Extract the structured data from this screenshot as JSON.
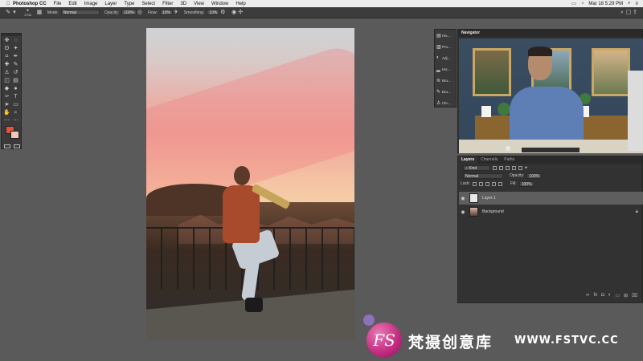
{
  "menubar": {
    "app_name": "Photoshop CC",
    "items": [
      "File",
      "Edit",
      "Image",
      "Layer",
      "Type",
      "Select",
      "Filter",
      "3D",
      "View",
      "Window",
      "Help"
    ],
    "clock": "Mar 18 5:29 PM"
  },
  "options_bar": {
    "brush_size": "1706",
    "mode_label": "Mode:",
    "mode_value": "Normal",
    "opacity_label": "Opacity:",
    "opacity_value": "100%",
    "flow_label": "Flow:",
    "flow_value": "10%",
    "smoothing_label": "Smoothing:",
    "smoothing_value": "10%"
  },
  "colors": {
    "foreground": "#e0553d",
    "background": "#f2c7b5",
    "ui_dark": "#3c3c3c"
  },
  "dock": {
    "items": [
      "His...",
      "Pro...",
      "Adj...",
      "His...",
      "Bru...",
      "Bru...",
      "Cle..."
    ]
  },
  "navigator": {
    "title": "Navigator"
  },
  "layers_panel": {
    "tabs": [
      "Layers",
      "Channels",
      "Paths"
    ],
    "filter_kind": "Kind",
    "blend_mode": "Normal",
    "opacity_label": "Opacity:",
    "opacity_value": "100%",
    "lock_label": "Lock:",
    "fill_label": "Fill:",
    "fill_value": "100%",
    "layers": [
      {
        "name": "Layer 1",
        "selected": true
      },
      {
        "name": "Background",
        "selected": false,
        "locked": true
      }
    ]
  },
  "watermark": {
    "logo_text": "FS",
    "chinese": "梵摄创意库",
    "url": "WWW.FSTVC.CC"
  }
}
